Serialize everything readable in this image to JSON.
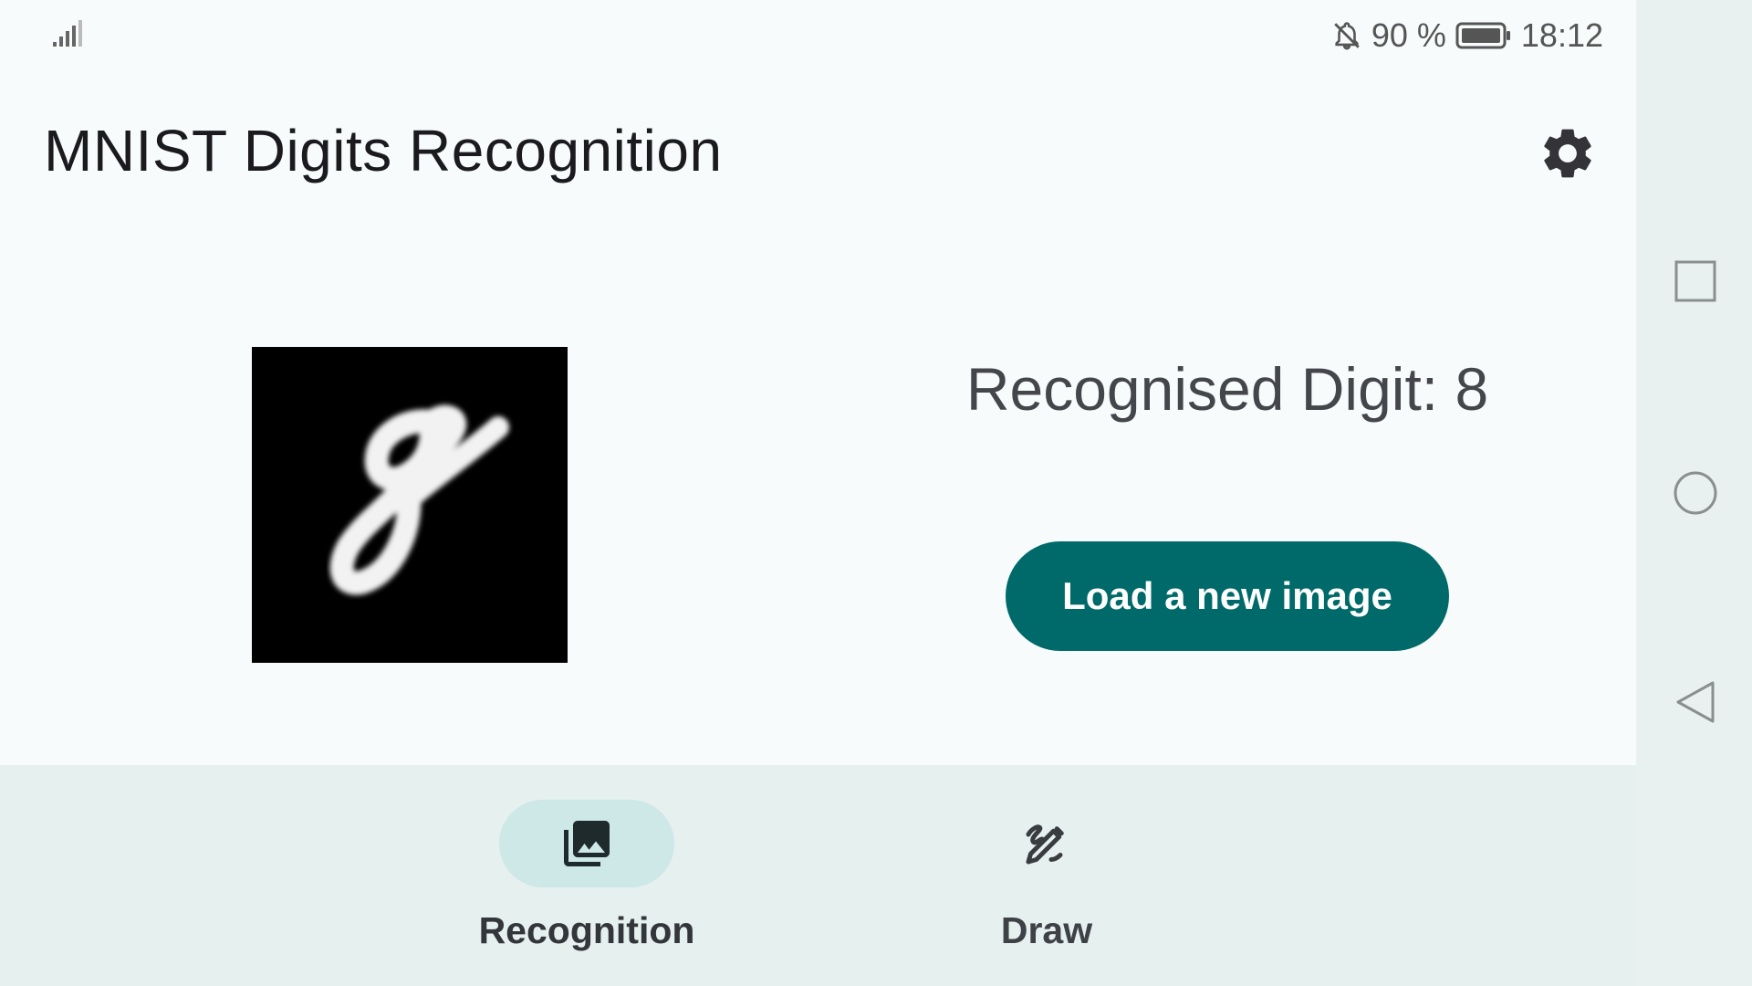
{
  "status_bar": {
    "signal_icon": "signal-strength-icon",
    "mute_icon": "notifications-off-icon",
    "battery_text": "90 %",
    "battery_icon": "battery-icon",
    "time": "18:12"
  },
  "header": {
    "title": "MNIST Digits Recognition",
    "settings_icon": "gear-icon"
  },
  "main": {
    "image_alt": "handwritten digit image",
    "recognised_text": "Recognised Digit: 8",
    "load_button_label": "Load a new image"
  },
  "bottom_nav": {
    "items": [
      {
        "label": "Recognition",
        "icon": "photo-library-icon",
        "active": true
      },
      {
        "label": "Draw",
        "icon": "draw-icon",
        "active": false
      }
    ]
  },
  "system_nav": {
    "buttons": [
      "recents-square-icon",
      "home-circle-icon",
      "back-triangle-icon"
    ]
  },
  "colors": {
    "accent": "#006a6a",
    "background": "#f8fbfb",
    "nav_background": "#e5f0ef",
    "active_pill": "#cde8e7"
  }
}
